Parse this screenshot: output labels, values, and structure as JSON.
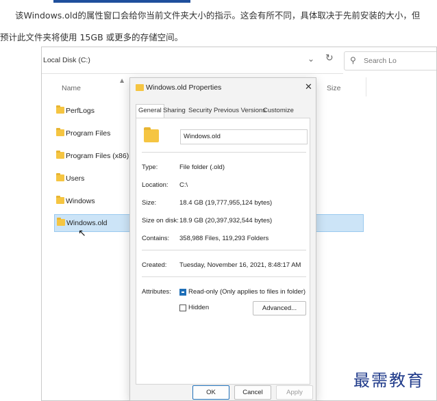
{
  "article": {
    "line1": "该Windows.old的属性窗口会给你当前文件夹大小的指示。这会有所不同，具体取决于先前安装的大小，但",
    "line2": "预计此文件夹将使用 15GB 或更多的存储空间。"
  },
  "explorer": {
    "address": "Local Disk (C:)",
    "search_placeholder": "Search Lo",
    "columns": {
      "name": "Name",
      "size": "Size"
    },
    "items": [
      {
        "label": "PerfLogs"
      },
      {
        "label": "Program Files"
      },
      {
        "label": "Program Files (x86)"
      },
      {
        "label": "Users"
      },
      {
        "label": "Windows"
      },
      {
        "label": "Windows.old",
        "selected": true
      }
    ]
  },
  "dialog": {
    "title": "Windows.old Properties",
    "tabs": [
      "General",
      "Sharing",
      "Security",
      "Previous Versions",
      "Customize"
    ],
    "active_tab": "General",
    "folder_name": "Windows.old",
    "fields": {
      "type_label": "Type:",
      "type_value": "File folder (.old)",
      "location_label": "Location:",
      "location_value": "C:\\",
      "size_label": "Size:",
      "size_value": "18.4 GB (19,777,955,124 bytes)",
      "size_on_disk_label": "Size on disk:",
      "size_on_disk_value": "18.9 GB (20,397,932,544 bytes)",
      "contains_label": "Contains:",
      "contains_value": "358,988 Files, 119,293 Folders",
      "created_label": "Created:",
      "created_value": "Tuesday, November 16, 2021, 8:48:17 AM",
      "attributes_label": "Attributes:"
    },
    "attributes": {
      "readonly_label": "Read-only (Only applies to files in folder)",
      "hidden_label": "Hidden",
      "advanced_button": "Advanced..."
    },
    "buttons": {
      "ok": "OK",
      "cancel": "Cancel",
      "apply": "Apply"
    }
  },
  "watermark": "最需教育",
  "colors": {
    "selection": "#cce4f7",
    "folder": "#f5c542",
    "accent": "#1f6fb8",
    "watermark": "#1f3a8a"
  }
}
